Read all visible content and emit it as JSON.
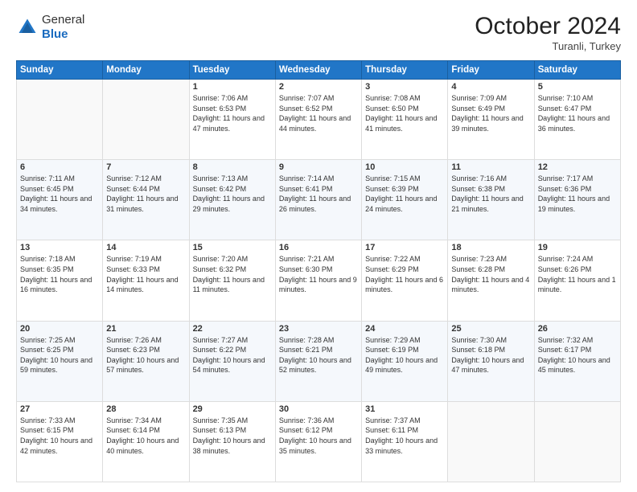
{
  "header": {
    "logo_line1": "General",
    "logo_line2": "Blue",
    "month": "October 2024",
    "location": "Turanli, Turkey"
  },
  "days_of_week": [
    "Sunday",
    "Monday",
    "Tuesday",
    "Wednesday",
    "Thursday",
    "Friday",
    "Saturday"
  ],
  "weeks": [
    [
      {
        "day": "",
        "info": ""
      },
      {
        "day": "",
        "info": ""
      },
      {
        "day": "1",
        "info": "Sunrise: 7:06 AM\nSunset: 6:53 PM\nDaylight: 11 hours and 47 minutes."
      },
      {
        "day": "2",
        "info": "Sunrise: 7:07 AM\nSunset: 6:52 PM\nDaylight: 11 hours and 44 minutes."
      },
      {
        "day": "3",
        "info": "Sunrise: 7:08 AM\nSunset: 6:50 PM\nDaylight: 11 hours and 41 minutes."
      },
      {
        "day": "4",
        "info": "Sunrise: 7:09 AM\nSunset: 6:49 PM\nDaylight: 11 hours and 39 minutes."
      },
      {
        "day": "5",
        "info": "Sunrise: 7:10 AM\nSunset: 6:47 PM\nDaylight: 11 hours and 36 minutes."
      }
    ],
    [
      {
        "day": "6",
        "info": "Sunrise: 7:11 AM\nSunset: 6:45 PM\nDaylight: 11 hours and 34 minutes."
      },
      {
        "day": "7",
        "info": "Sunrise: 7:12 AM\nSunset: 6:44 PM\nDaylight: 11 hours and 31 minutes."
      },
      {
        "day": "8",
        "info": "Sunrise: 7:13 AM\nSunset: 6:42 PM\nDaylight: 11 hours and 29 minutes."
      },
      {
        "day": "9",
        "info": "Sunrise: 7:14 AM\nSunset: 6:41 PM\nDaylight: 11 hours and 26 minutes."
      },
      {
        "day": "10",
        "info": "Sunrise: 7:15 AM\nSunset: 6:39 PM\nDaylight: 11 hours and 24 minutes."
      },
      {
        "day": "11",
        "info": "Sunrise: 7:16 AM\nSunset: 6:38 PM\nDaylight: 11 hours and 21 minutes."
      },
      {
        "day": "12",
        "info": "Sunrise: 7:17 AM\nSunset: 6:36 PM\nDaylight: 11 hours and 19 minutes."
      }
    ],
    [
      {
        "day": "13",
        "info": "Sunrise: 7:18 AM\nSunset: 6:35 PM\nDaylight: 11 hours and 16 minutes."
      },
      {
        "day": "14",
        "info": "Sunrise: 7:19 AM\nSunset: 6:33 PM\nDaylight: 11 hours and 14 minutes."
      },
      {
        "day": "15",
        "info": "Sunrise: 7:20 AM\nSunset: 6:32 PM\nDaylight: 11 hours and 11 minutes."
      },
      {
        "day": "16",
        "info": "Sunrise: 7:21 AM\nSunset: 6:30 PM\nDaylight: 11 hours and 9 minutes."
      },
      {
        "day": "17",
        "info": "Sunrise: 7:22 AM\nSunset: 6:29 PM\nDaylight: 11 hours and 6 minutes."
      },
      {
        "day": "18",
        "info": "Sunrise: 7:23 AM\nSunset: 6:28 PM\nDaylight: 11 hours and 4 minutes."
      },
      {
        "day": "19",
        "info": "Sunrise: 7:24 AM\nSunset: 6:26 PM\nDaylight: 11 hours and 1 minute."
      }
    ],
    [
      {
        "day": "20",
        "info": "Sunrise: 7:25 AM\nSunset: 6:25 PM\nDaylight: 10 hours and 59 minutes."
      },
      {
        "day": "21",
        "info": "Sunrise: 7:26 AM\nSunset: 6:23 PM\nDaylight: 10 hours and 57 minutes."
      },
      {
        "day": "22",
        "info": "Sunrise: 7:27 AM\nSunset: 6:22 PM\nDaylight: 10 hours and 54 minutes."
      },
      {
        "day": "23",
        "info": "Sunrise: 7:28 AM\nSunset: 6:21 PM\nDaylight: 10 hours and 52 minutes."
      },
      {
        "day": "24",
        "info": "Sunrise: 7:29 AM\nSunset: 6:19 PM\nDaylight: 10 hours and 49 minutes."
      },
      {
        "day": "25",
        "info": "Sunrise: 7:30 AM\nSunset: 6:18 PM\nDaylight: 10 hours and 47 minutes."
      },
      {
        "day": "26",
        "info": "Sunrise: 7:32 AM\nSunset: 6:17 PM\nDaylight: 10 hours and 45 minutes."
      }
    ],
    [
      {
        "day": "27",
        "info": "Sunrise: 7:33 AM\nSunset: 6:15 PM\nDaylight: 10 hours and 42 minutes."
      },
      {
        "day": "28",
        "info": "Sunrise: 7:34 AM\nSunset: 6:14 PM\nDaylight: 10 hours and 40 minutes."
      },
      {
        "day": "29",
        "info": "Sunrise: 7:35 AM\nSunset: 6:13 PM\nDaylight: 10 hours and 38 minutes."
      },
      {
        "day": "30",
        "info": "Sunrise: 7:36 AM\nSunset: 6:12 PM\nDaylight: 10 hours and 35 minutes."
      },
      {
        "day": "31",
        "info": "Sunrise: 7:37 AM\nSunset: 6:11 PM\nDaylight: 10 hours and 33 minutes."
      },
      {
        "day": "",
        "info": ""
      },
      {
        "day": "",
        "info": ""
      }
    ]
  ]
}
